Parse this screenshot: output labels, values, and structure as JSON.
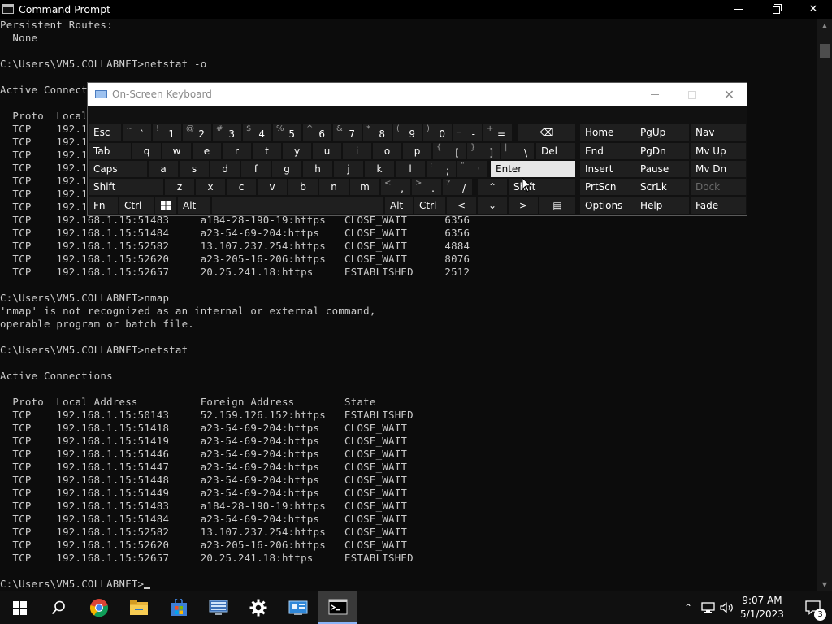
{
  "window": {
    "title": "Command Prompt"
  },
  "console_lines": [
    "Persistent Routes:",
    "  None",
    "",
    "C:\\Users\\VM5.COLLABNET>netstat -o",
    "",
    "Active Connections",
    "",
    "  Proto  Local Address          Foreign Address        State           PID",
    "  TCP    192.168.1.15:50143     52.159.126.152:https   ESTABLISHED     8076",
    "  TCP    192.168.1.15:51418     a23-54-69-204:https    CLOSE_WAIT      6356",
    "  TCP    192.168.1.15:51419     a23-54-69-204:https    CLOSE_WAIT      6356",
    "  TCP    192.168.1.15:51446     a23-54-69-204:https    CLOSE_WAIT      6356",
    "  TCP    192.168.1.15:51447     a23-54-69-204:https    CLOSE_WAIT      6356",
    "  TCP    192.168.1.15:51448     a23-54-69-204:https    CLOSE_WAIT      6356",
    "  TCP    192.168.1.15:51449     a23-54-69-204:https    CLOSE_WAIT      6356",
    "  TCP    192.168.1.15:51483     a184-28-190-19:https   CLOSE_WAIT      6356",
    "  TCP    192.168.1.15:51484     a23-54-69-204:https    CLOSE_WAIT      6356",
    "  TCP    192.168.1.15:52582     13.107.237.254:https   CLOSE_WAIT      4884",
    "  TCP    192.168.1.15:52620     a23-205-16-206:https   CLOSE_WAIT      8076",
    "  TCP    192.168.1.15:52657     20.25.241.18:https     ESTABLISHED     2512",
    "",
    "C:\\Users\\VM5.COLLABNET>nmap",
    "'nmap' is not recognized as an internal or external command,",
    "operable program or batch file.",
    "",
    "C:\\Users\\VM5.COLLABNET>netstat",
    "",
    "Active Connections",
    "",
    "  Proto  Local Address          Foreign Address        State",
    "  TCP    192.168.1.15:50143     52.159.126.152:https   ESTABLISHED",
    "  TCP    192.168.1.15:51418     a23-54-69-204:https    CLOSE_WAIT",
    "  TCP    192.168.1.15:51419     a23-54-69-204:https    CLOSE_WAIT",
    "  TCP    192.168.1.15:51446     a23-54-69-204:https    CLOSE_WAIT",
    "  TCP    192.168.1.15:51447     a23-54-69-204:https    CLOSE_WAIT",
    "  TCP    192.168.1.15:51448     a23-54-69-204:https    CLOSE_WAIT",
    "  TCP    192.168.1.15:51449     a23-54-69-204:https    CLOSE_WAIT",
    "  TCP    192.168.1.15:51483     a184-28-190-19:https   CLOSE_WAIT",
    "  TCP    192.168.1.15:51484     a23-54-69-204:https    CLOSE_WAIT",
    "  TCP    192.168.1.15:52582     13.107.237.254:https   CLOSE_WAIT",
    "  TCP    192.168.1.15:52620     a23-205-16-206:https   CLOSE_WAIT",
    "  TCP    192.168.1.15:52657     20.25.241.18:https     ESTABLISHED",
    "",
    "C:\\Users\\VM5.COLLABNET>"
  ],
  "osk": {
    "title": "On-Screen Keyboard",
    "keys": {
      "esc": "Esc",
      "tab": "Tab",
      "caps": "Caps",
      "shift": "Shift",
      "fn": "Fn",
      "ctrl": "Ctrl",
      "alt": "Alt",
      "alt_right": "Alt",
      "ctrl_right": "Ctrl",
      "del": "Del",
      "enter": "Enter",
      "shift_right": "Shift",
      "home": "Home",
      "pgup": "PgUp",
      "nav": "Nav",
      "end": "End",
      "pgdn": "PgDn",
      "mvup": "Mv Up",
      "insert": "Insert",
      "pause": "Pause",
      "mvdn": "Mv Dn",
      "prtscn": "PrtScn",
      "scrlk": "ScrLk",
      "dock": "Dock",
      "options": "Options",
      "help": "Help",
      "fade": "Fade"
    },
    "row1": [
      {
        "sym": "~",
        "main": "`"
      },
      {
        "sym": "!",
        "main": "1"
      },
      {
        "sym": "@",
        "main": "2"
      },
      {
        "sym": "#",
        "main": "3"
      },
      {
        "sym": "$",
        "main": "4"
      },
      {
        "sym": "%",
        "main": "5"
      },
      {
        "sym": "^",
        "main": "6"
      },
      {
        "sym": "&",
        "main": "7"
      },
      {
        "sym": "*",
        "main": "8"
      },
      {
        "sym": "(",
        "main": "9"
      },
      {
        "sym": ")",
        "main": "0"
      },
      {
        "sym": "_",
        "main": "-"
      },
      {
        "sym": "+",
        "main": "="
      }
    ],
    "row2": [
      "q",
      "w",
      "e",
      "r",
      "t",
      "y",
      "u",
      "i",
      "o",
      "p"
    ],
    "row2_sym": [
      {
        "sym": "{",
        "main": "["
      },
      {
        "sym": "}",
        "main": "]"
      },
      {
        "sym": "|",
        "main": "\\"
      }
    ],
    "row3": [
      "a",
      "s",
      "d",
      "f",
      "g",
      "h",
      "j",
      "k",
      "l"
    ],
    "row3_sym": [
      {
        "sym": ":",
        "main": ";"
      },
      {
        "sym": "\"",
        "main": "'"
      }
    ],
    "row4": [
      "z",
      "x",
      "c",
      "v",
      "b",
      "n",
      "m"
    ],
    "row4_sym": [
      {
        "sym": "<",
        "main": ","
      },
      {
        "sym": ">",
        "main": "."
      },
      {
        "sym": "?",
        "main": "/"
      }
    ]
  },
  "taskbar": {
    "time": "9:07 AM",
    "date": "5/1/2023",
    "notification_count": "3"
  },
  "colors": {
    "console_bg": "#0c0c0c",
    "console_text": "#cccccc",
    "osk_key": "#1f1f1f",
    "osk_key_highlight": "#e6e6e6",
    "taskbar": "#101010"
  }
}
